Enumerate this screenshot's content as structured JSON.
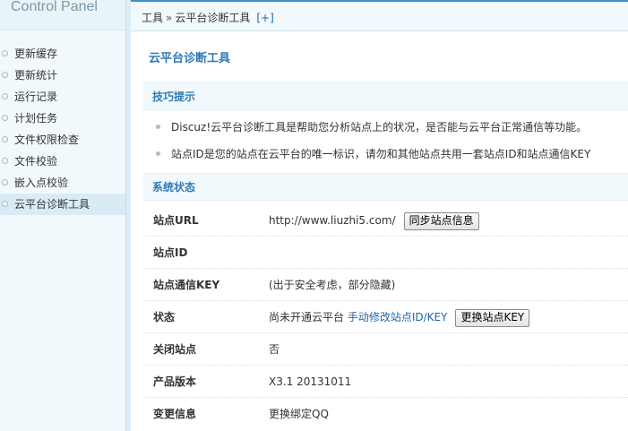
{
  "sidebar": {
    "panel_title": "Control Panel",
    "items": [
      {
        "label": "更新缓存"
      },
      {
        "label": "更新统计"
      },
      {
        "label": "运行记录"
      },
      {
        "label": "计划任务"
      },
      {
        "label": "文件权限检查"
      },
      {
        "label": "文件校验"
      },
      {
        "label": "嵌入点校验"
      },
      {
        "label": "云平台诊断工具",
        "active": true
      }
    ]
  },
  "breadcrumb": {
    "root": "工具",
    "separator": "»",
    "current": "云平台诊断工具",
    "add_label": "[+]"
  },
  "main": {
    "title": "云平台诊断工具",
    "tips": {
      "heading": "技巧提示",
      "items": [
        "Discuz!云平台诊断工具是帮助您分析站点上的状况，是否能与云平台正常通信等功能。",
        "站点ID是您的站点在云平台的唯一标识，请勿和其他站点共用一套站点ID和站点通信KEY"
      ]
    },
    "status": {
      "heading": "系统状态",
      "rows": {
        "site_url": {
          "label": "站点URL",
          "value": "http://www.liuzhi5.com/",
          "button": "同步站点信息"
        },
        "site_id": {
          "label": "站点ID",
          "value": ""
        },
        "site_key": {
          "label": "站点通信KEY",
          "value": "(出于安全考虑，部分隐藏)"
        },
        "state": {
          "label": "状态",
          "value": "尚未开通云平台",
          "link": "手动修改站点ID/KEY",
          "button": "更换站点KEY"
        },
        "closed": {
          "label": "关闭站点",
          "value": "否"
        },
        "version": {
          "label": "产品版本",
          "value": "X3.1 20131011"
        },
        "change": {
          "label": "变更信息",
          "link": "更换绑定QQ"
        }
      }
    }
  },
  "colors": {
    "accent": "#2e7bb4",
    "link": "#2366a8",
    "sidebar_bg": "#f2f9fd",
    "topbar_border": "#3a92c4"
  }
}
